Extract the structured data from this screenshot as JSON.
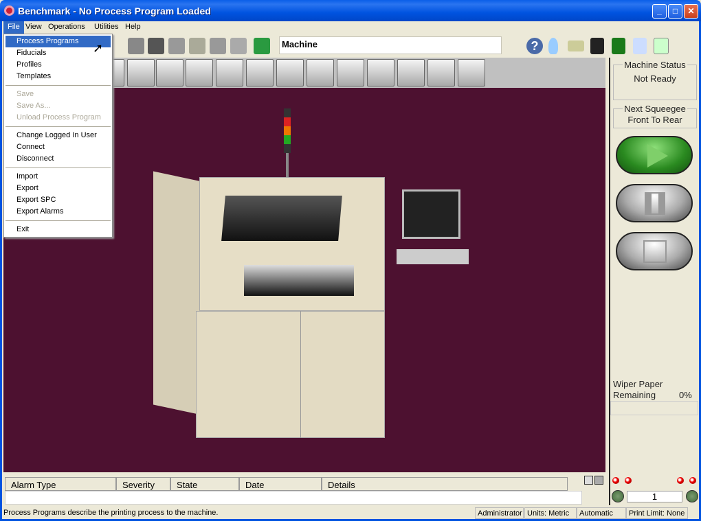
{
  "window": {
    "title": "Benchmark - No Process Program Loaded"
  },
  "menubar": [
    "File",
    "View",
    "Operations",
    "Utilities",
    "Help"
  ],
  "file_menu": {
    "groups": [
      [
        {
          "label": "Process Programs",
          "state": "highlighted"
        },
        {
          "label": "Fiducials"
        },
        {
          "label": "Profiles"
        },
        {
          "label": "Templates"
        }
      ],
      [
        {
          "label": "Save",
          "state": "disabled"
        },
        {
          "label": "Save As...",
          "state": "disabled"
        },
        {
          "label": "Unload Process Program",
          "state": "disabled"
        }
      ],
      [
        {
          "label": "Change Logged In User"
        },
        {
          "label": "Connect"
        },
        {
          "label": "Disconnect"
        }
      ],
      [
        {
          "label": "Import"
        },
        {
          "label": "Export"
        },
        {
          "label": "Export SPC"
        },
        {
          "label": "Export Alarms"
        }
      ],
      [
        {
          "label": "Exit"
        }
      ]
    ]
  },
  "toolbar": {
    "machine_field": "Machine",
    "right_icons": [
      "help-icon",
      "lightbulb-icon",
      "memory-card-icon",
      "save-disk-icon",
      "board-icon",
      "report-icon",
      "spreadsheet-icon"
    ]
  },
  "right_panel": {
    "machine_status_label": "Machine Status",
    "machine_status": "Not Ready",
    "next_squeegee_label": "Next Squeegee",
    "next_squeegee": "Front To Rear",
    "wiper_label_1": "Wiper Paper",
    "wiper_label_2": "Remaining",
    "wiper_value": "0%",
    "wiper_percent": 0,
    "counter": "1"
  },
  "alarm_table": {
    "columns": [
      "Alarm Type",
      "Severity",
      "State",
      "Date",
      "Details"
    ]
  },
  "statusbar": {
    "message": "Process Programs describe the printing process to the machine.",
    "user": "Administrator",
    "units": "Units: Metric",
    "mode": "Automatic",
    "print_limit": "Print Limit: None"
  },
  "colors": {
    "background": "#4d1130",
    "accent": "#316ac5"
  }
}
